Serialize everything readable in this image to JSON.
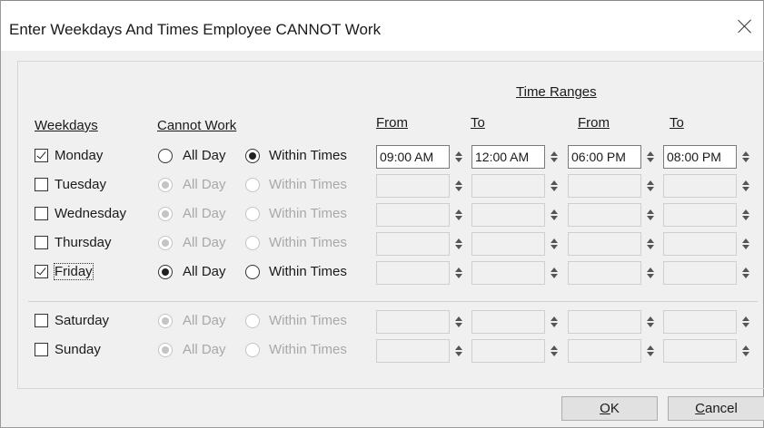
{
  "dialog": {
    "title": "Enter Weekdays And Times Employee CANNOT Work"
  },
  "headers": {
    "time_ranges": "Time Ranges",
    "weekdays": "Weekdays",
    "cannot_work": "Cannot Work",
    "from1": "From",
    "to1": "To",
    "from2": "From",
    "to2": "To"
  },
  "options": {
    "all_day": "All Day",
    "within_times": "Within Times"
  },
  "days": [
    {
      "name": "Monday",
      "checked": true,
      "mode": "within",
      "times": [
        "09:00 AM",
        "12:00 AM",
        "06:00 PM",
        "08:00 PM"
      ]
    },
    {
      "name": "Tuesday",
      "checked": false,
      "mode": "allday",
      "times": [
        "",
        "",
        "",
        ""
      ]
    },
    {
      "name": "Wednesday",
      "checked": false,
      "mode": "allday",
      "times": [
        "",
        "",
        "",
        ""
      ]
    },
    {
      "name": "Thursday",
      "checked": false,
      "mode": "allday",
      "times": [
        "",
        "",
        "",
        ""
      ]
    },
    {
      "name": "Friday",
      "checked": true,
      "mode": "allday",
      "times": [
        "",
        "",
        "",
        ""
      ]
    },
    {
      "name": "Saturday",
      "checked": false,
      "mode": "allday",
      "times": [
        "",
        "",
        "",
        ""
      ]
    },
    {
      "name": "Sunday",
      "checked": false,
      "mode": "allday",
      "times": [
        "",
        "",
        "",
        ""
      ]
    }
  ],
  "buttons": {
    "ok": "OK",
    "cancel": "Cancel"
  }
}
